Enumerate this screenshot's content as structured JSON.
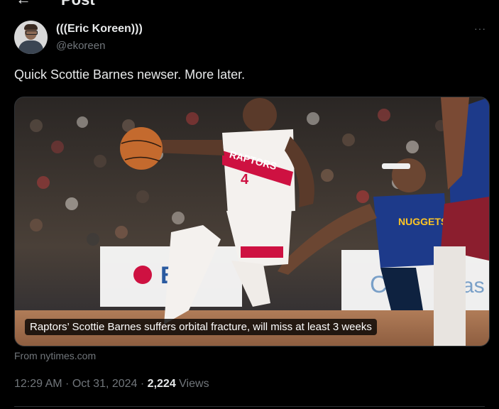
{
  "header": {
    "back_glyph": "←",
    "title": "Post"
  },
  "author": {
    "display_name": "(((Eric Koreen)))",
    "handle": "@ekoreen"
  },
  "more_glyph": "···",
  "tweet": {
    "text": "Quick Scottie Barnes newser. More later."
  },
  "link_card": {
    "caption": "Raptors’ Scottie Barnes suffers orbital fracture, will miss at least 3 weeks",
    "source": "From nytimes.com",
    "image_jersey_text": "RAPTORS",
    "image_jersey_number": "4"
  },
  "meta": {
    "time": "12:29 AM",
    "separator": " · ",
    "date": "Oct 31, 2024",
    "views_count": "2,224",
    "views_label": "Views"
  },
  "colors": {
    "background": "#000000",
    "text": "#e7e9ea",
    "muted": "#71767b",
    "border": "#2f3336",
    "raptors_red": "#ce1141",
    "nuggets_navy": "#0e2240"
  }
}
